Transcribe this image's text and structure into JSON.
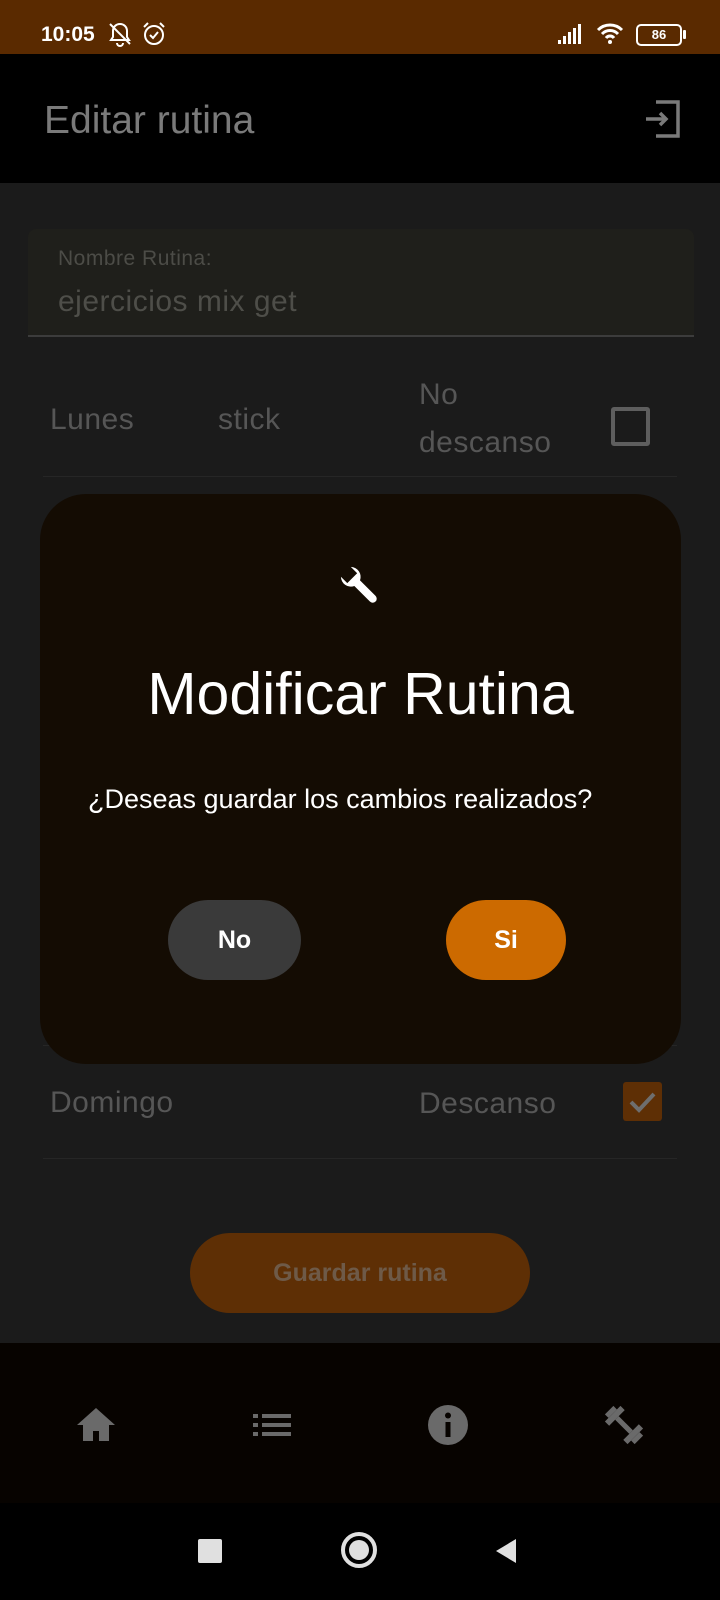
{
  "status_bar": {
    "time": "10:05",
    "battery": "86",
    "icons": [
      "bell-off-icon",
      "alarm-icon",
      "signal-icon",
      "wifi-icon",
      "battery-icon"
    ]
  },
  "app_bar": {
    "title": "Editar rutina",
    "action_icon": "exit-icon"
  },
  "form": {
    "name_label": "Nombre Rutina:",
    "name_value": "ejercicios mix get"
  },
  "days": [
    {
      "day": "Lunes",
      "routine": "stick",
      "rest_label_line1": "No",
      "rest_label_line2": "descanso",
      "rest": false
    },
    {
      "day": "Domingo",
      "routine": "",
      "rest_label": "Descanso",
      "rest": true
    }
  ],
  "save_button": "Guardar rutina",
  "dialog": {
    "icon": "wrench-icon",
    "title": "Modificar Rutina",
    "message": "¿Deseas guardar los cambios realizados?",
    "no_label": "No",
    "yes_label": "Si"
  },
  "bottom_nav": {
    "items": [
      "home-icon",
      "list-icon",
      "info-icon",
      "dumbbell-icon"
    ]
  },
  "colors": {
    "status_bar": "#5a2a00",
    "accent": "#cc6a00",
    "dialog_bg": "#140c03"
  }
}
